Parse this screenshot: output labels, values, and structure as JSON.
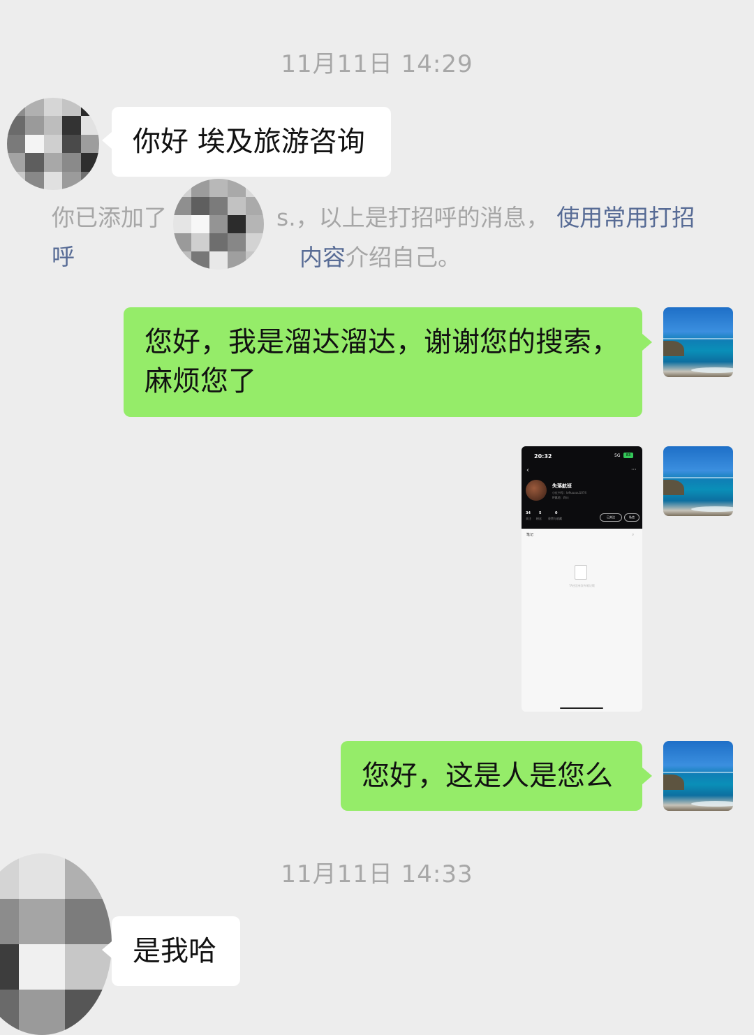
{
  "chat": {
    "timestamp1": "11月11日 14:29",
    "timestamp2": "11月11日 14:33",
    "msg_greeting": "你好 埃及旅游咨询",
    "system_notice": {
      "prefix": "你已添加了",
      "suffix": "s.，以上是打招呼的消息，",
      "link": "使用常用打招呼内容",
      "link_part1": "使用常用打招呼",
      "link_part2": "内容",
      "tail": "介绍自己。"
    },
    "msg_self_1": "您好，我是溜达溜达，谢谢您的搜索，麻烦您了",
    "msg_self_2": "您好，这是人是您么",
    "msg_reply": "是我哈"
  },
  "screenshot": {
    "status_time": "20:32",
    "signal": "5G",
    "battery": "83",
    "profile_name": "失落航班",
    "profile_id": "小红书号：lo9uuuuu1074",
    "profile_ip": "IP属地：四川",
    "stats": [
      {
        "value": "34",
        "label": "关注"
      },
      {
        "value": "5",
        "label": "粉丝"
      },
      {
        "value": "0",
        "label": "获赞与收藏"
      }
    ],
    "follow_btn": "已关注",
    "dm_btn": "私信",
    "tab_label": "笔记",
    "empty_text": "TA还没有发布笔记哦"
  },
  "colors": {
    "background": "#ededed",
    "bubble_self": "#95ec69",
    "bubble_other": "#ffffff",
    "link": "#576b95",
    "timestamp": "#a7a7a7"
  }
}
